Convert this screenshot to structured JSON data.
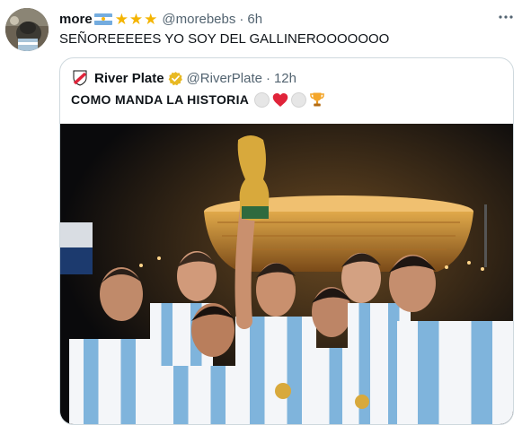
{
  "tweet": {
    "display_name": "more",
    "handle": "@morebebs",
    "separator": "·",
    "time": "6h",
    "text": "SEÑOREEEEES YO SOY DEL GALLINEROOOOOOO",
    "stars": "★★★",
    "more_icon": "more-horizontal-icon"
  },
  "quoted_tweet": {
    "display_name": "River Plate",
    "handle": "@RiverPlate",
    "separator": "·",
    "time": "12h",
    "text": "COMO MANDA LA HISTORIA",
    "verified": true,
    "emoji": [
      "white-circle",
      "red-heart",
      "white-circle",
      "trophy"
    ]
  },
  "colors": {
    "text_primary": "#0f1419",
    "text_secondary": "#536471",
    "border": "#cfd9de",
    "flag_blue": "#74acdf",
    "star_gold": "#f4b400",
    "verified_gold": "#e8b923",
    "heart_red": "#e0243a"
  }
}
